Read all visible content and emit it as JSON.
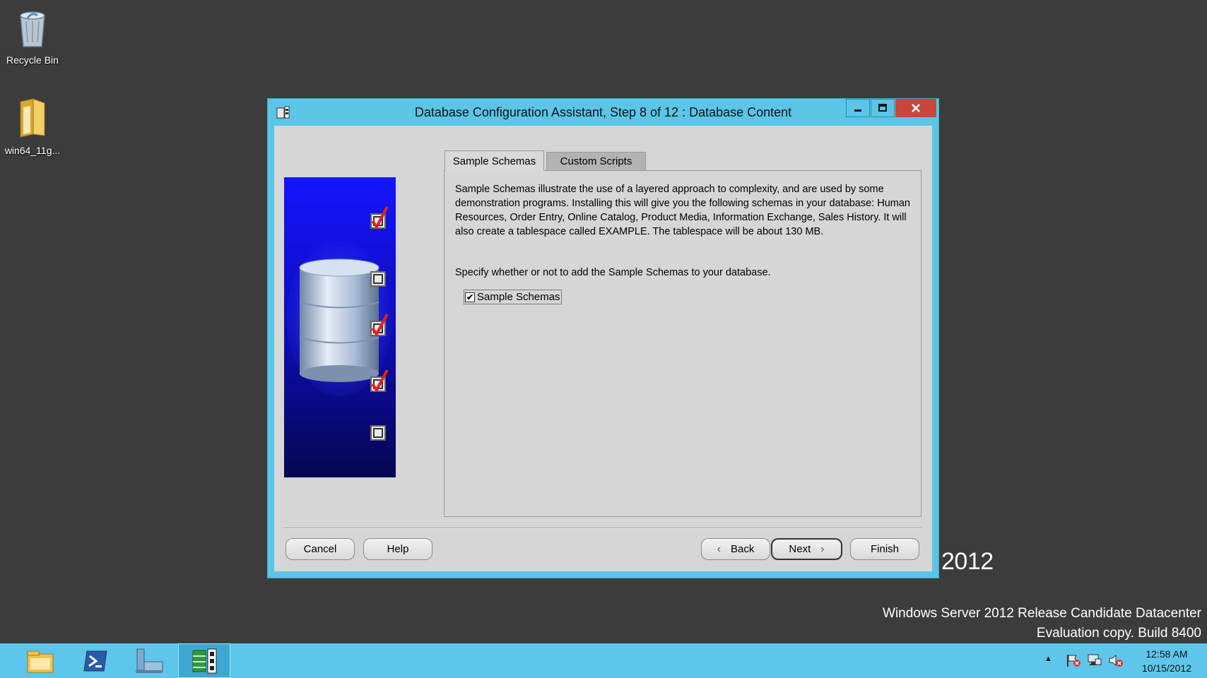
{
  "desktop": {
    "icons": [
      {
        "label": "Recycle Bin",
        "icon": "recycle-bin-icon"
      },
      {
        "label": "win64_11g...",
        "icon": "folder-icon"
      }
    ],
    "watermark_line1": "Windows Server 2012 Release Candidate Datacenter",
    "watermark_line2": "Evaluation copy. Build 8400",
    "year_text": "2012"
  },
  "window": {
    "title": "Database Configuration Assistant, Step 8 of 12 : Database Content",
    "icon": "dbca-app-icon",
    "controls": {
      "minimize": "minimize-icon",
      "maximize": "maximize-icon",
      "close": "close-icon"
    }
  },
  "tabs": [
    {
      "label": "Sample Schemas",
      "active": true
    },
    {
      "label": "Custom Scripts",
      "active": false
    }
  ],
  "content": {
    "description": "Sample Schemas illustrate the use of a layered approach to complexity, and are used by some demonstration programs. Installing this will give you the following schemas in your database: Human Resources, Order Entry, Online Catalog, Product Media, Information Exchange, Sales History. It will also create a tablespace called EXAMPLE. The tablespace will be about 130 MB.",
    "prompt": "Specify whether or not to add the Sample Schemas to your database.",
    "checkbox": {
      "label": "Sample Schemas",
      "checked": true
    }
  },
  "buttons": {
    "cancel": "Cancel",
    "help": "Help",
    "back": "Back",
    "next": "Next",
    "finish": "Finish"
  },
  "taskbar": {
    "apps": [
      "file-explorer-icon",
      "powershell-icon",
      "server-manager-icon",
      "dbca-running-icon"
    ],
    "tray_icons": [
      "show-hidden-icons-chevron",
      "action-center-flag-icon",
      "network-icon",
      "volume-icon"
    ],
    "time": "12:58 AM",
    "date": "10/15/2012"
  },
  "colors": {
    "accent": "#5bc5e8",
    "desktop": "#3c3c3c",
    "close": "#c9463d",
    "check": "#e02020"
  }
}
